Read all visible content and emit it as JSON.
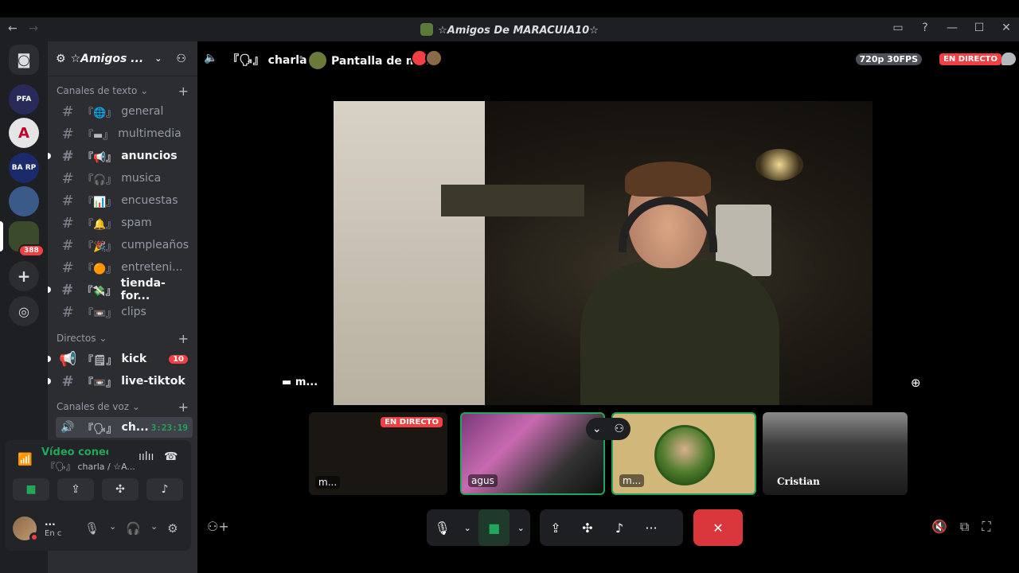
{
  "window": {
    "title": "☆Amigos De MARACUIA10☆",
    "back": "←",
    "forward": "→",
    "inbox_icon": "inbox-icon",
    "help": "?",
    "minimize": "—",
    "maximize": "☐",
    "close": "✕"
  },
  "guilds": {
    "home": "◙",
    "items": [
      {
        "label": "PFA"
      },
      {
        "label": "A"
      },
      {
        "label": "BA RP"
      },
      {
        "label": ""
      },
      {
        "label": ""
      }
    ],
    "folder_badge": "388",
    "add": "+",
    "discover": "◎"
  },
  "server": {
    "name": "☆Amigos ...",
    "gear": "⚙",
    "chevron": "⌄",
    "invite": "⚇"
  },
  "sidebar": {
    "categories": {
      "text": "Canales de texto ⌄",
      "direct": "Directos ⌄",
      "voice": "Canales de voz ⌄",
      "plus": "+"
    },
    "channels": [
      {
        "name": "general",
        "emoji": "『🌐』"
      },
      {
        "name": "multimedia",
        "emoji": "『▬』"
      },
      {
        "name": "anuncios",
        "emoji": "『📢』"
      },
      {
        "name": "musica",
        "emoji": "『🎧』"
      },
      {
        "name": "encuestas",
        "emoji": "『📊』"
      },
      {
        "name": "spam",
        "emoji": "『🔔』"
      },
      {
        "name": "cumpleaños",
        "emoji": "『🎉』"
      },
      {
        "name": "entreteni...",
        "emoji": "『🟠』"
      },
      {
        "name": "tienda-for...",
        "emoji": "『💸』"
      },
      {
        "name": "clips",
        "emoji": "『📼』"
      }
    ],
    "direct": [
      {
        "name": "kick",
        "emoji": "『🗒』",
        "count": "10"
      },
      {
        "name": "live-tiktok",
        "emoji": "『📼』"
      }
    ],
    "voice": [
      {
        "name": "ch...",
        "emoji": "『🗣』",
        "time": "3:23:19"
      }
    ]
  },
  "voice_panel": {
    "status": "Vídeo conectado",
    "sub": "『🗣』 charla / ☆A..."
  },
  "user_panel": {
    "name": "...",
    "status": "En c"
  },
  "topbar": {
    "speaker": "🔈",
    "channel": "『🗣』 charla",
    "dot": "•",
    "stream": "Pantalla de m...",
    "quality": "720p 30FPS",
    "live": "EN DIRECTO"
  },
  "stage": {
    "name": "m...",
    "zoom": "⊕"
  },
  "tiles": [
    {
      "label": "m...",
      "live": "EN DIRECTO"
    },
    {
      "label": "agus"
    },
    {
      "label": "m..."
    },
    {
      "label": "Cristian"
    }
  ],
  "tile_ctrl": {
    "chev": "⌄",
    "people": "⚇"
  },
  "controls": {
    "mic": "🎙",
    "chev": "⌄",
    "camera": "■",
    "screen": "⇪",
    "activities": "✣",
    "soundboard": "♪",
    "more": "···",
    "hangup": "✕",
    "add_user": "⚇+",
    "mute_out": "🔇",
    "popout": "⧉",
    "fullscreen": "⛶"
  },
  "colors": {
    "accent": "#23a55a",
    "danger": "#f23f43",
    "hangup": "#da373c"
  }
}
